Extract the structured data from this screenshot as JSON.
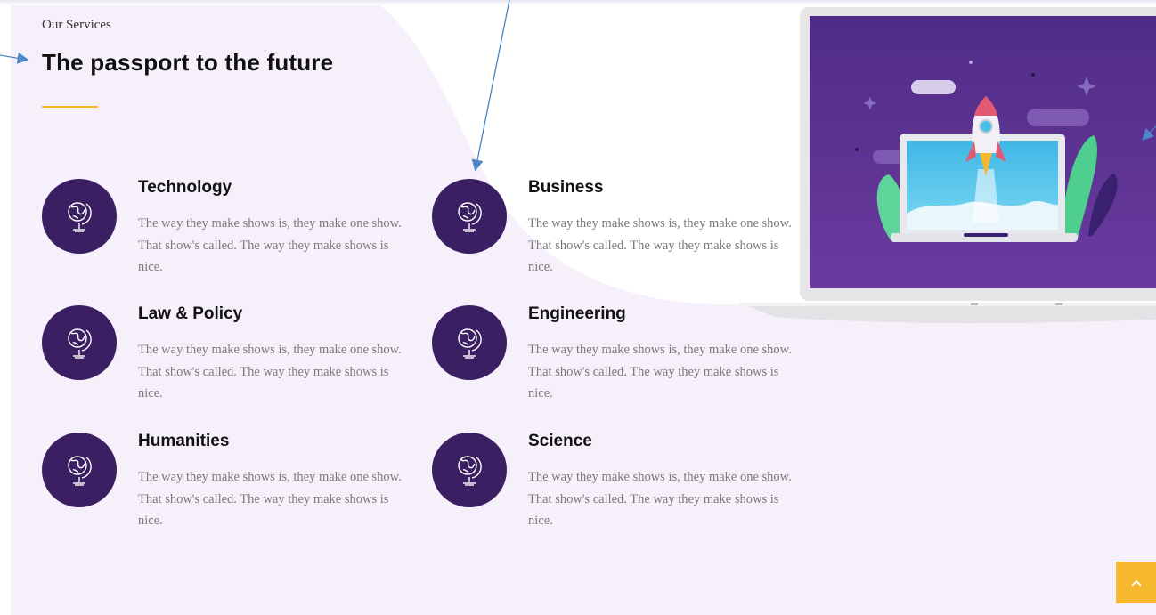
{
  "section": {
    "eyebrow": "Our Services",
    "title": "The passport to the future"
  },
  "services": [
    {
      "name": "Technology",
      "description": "The way they make shows is, they make one show. That show's called. The way they make shows is nice.",
      "icon": "globe-icon"
    },
    {
      "name": "Business",
      "description": "The way they make shows is, they make one show. That show's called. The way they make shows is nice.",
      "icon": "globe-icon"
    },
    {
      "name": "Law & Policy",
      "description": "The way they make shows is, they make one show. That show's called. The way they make shows is nice.",
      "icon": "globe-icon"
    },
    {
      "name": "Engineering",
      "description": "The way they make shows is, they make one show. That show's called. The way they make shows is nice.",
      "icon": "globe-icon"
    },
    {
      "name": "Humanities",
      "description": "The way they make shows is, they make one show. That show's called. The way they make shows is nice.",
      "icon": "globe-icon"
    },
    {
      "name": "Science",
      "description": "The way they make shows is, they make one show. That show's called. The way they make shows is nice.",
      "icon": "globe-icon"
    }
  ],
  "illustration": "laptop-rocket-illustration",
  "scroll_top_icon": "chevron-up-icon",
  "colors": {
    "accent": "#f5b82e",
    "icon_bg": "#3a1f63",
    "panel_bg": "#f6f0fb",
    "illustration_bg": "#5b3391"
  }
}
